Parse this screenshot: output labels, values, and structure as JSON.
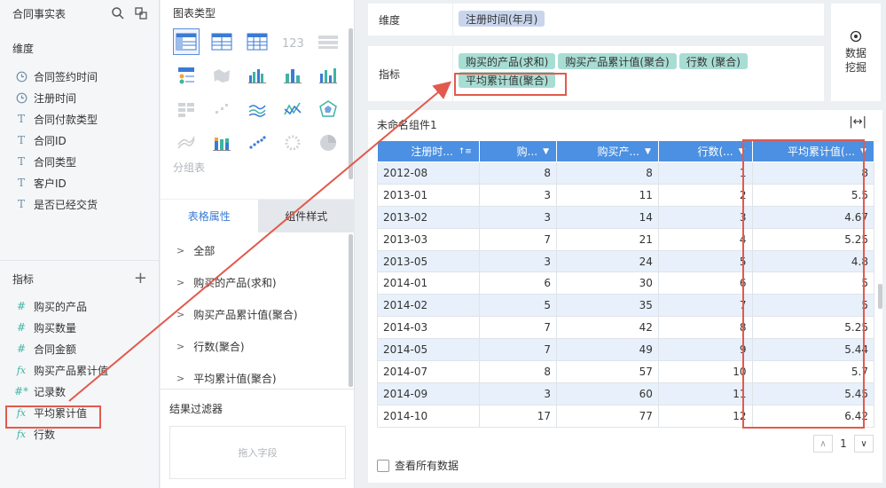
{
  "dataset": {
    "title": "合同事实表"
  },
  "dimensions": {
    "label": "维度",
    "fields": [
      {
        "type": "time",
        "label": "合同签约时间"
      },
      {
        "type": "time",
        "label": "注册时间"
      },
      {
        "type": "text",
        "label": "合同付款类型"
      },
      {
        "type": "text",
        "label": "合同ID"
      },
      {
        "type": "text",
        "label": "合同类型"
      },
      {
        "type": "text",
        "label": "客户ID"
      },
      {
        "type": "text",
        "label": "是否已经交货"
      }
    ]
  },
  "metrics": {
    "label": "指标",
    "add_icon": "plus-icon",
    "fields": [
      {
        "type": "num",
        "label": "购买的产品"
      },
      {
        "type": "num",
        "label": "购买数量"
      },
      {
        "type": "num",
        "label": "合同金额"
      },
      {
        "type": "fx",
        "label": "购买产品累计值"
      },
      {
        "type": "num",
        "label": "记录数"
      },
      {
        "type": "fx",
        "label": "平均累计值"
      },
      {
        "type": "fx",
        "label": "行数"
      }
    ]
  },
  "chart_panel": {
    "title": "图表类型",
    "group_label": "分组表",
    "tabs": [
      {
        "label": "表格属性",
        "active": true
      },
      {
        "label": "组件样式",
        "active": false
      }
    ],
    "props": [
      {
        "label": "全部"
      },
      {
        "label": "购买的产品(求和)"
      },
      {
        "label": "购买产品累计值(聚合)"
      },
      {
        "label": "行数(聚合)"
      },
      {
        "label": "平均累计值(聚合)"
      }
    ],
    "filter_title": "结果过滤器",
    "filter_placeholder": "拖入字段"
  },
  "shelves": {
    "dimension_label": "维度",
    "dimension_pills": [
      "注册时间(年月)"
    ],
    "metric_label": "指标",
    "metric_pills": [
      "购买的产品(求和)",
      "购买产品累计值(聚合)",
      "行数 (聚合)",
      "平均累计值(聚合)"
    ],
    "mining_label": "数据挖掘"
  },
  "widget": {
    "title": "未命名组件1",
    "columns": [
      "注册时...",
      "购...",
      "购买产...",
      "行数(...",
      "平均累计值(..."
    ],
    "rows": [
      [
        "2012-08",
        "8",
        "8",
        "1",
        "8"
      ],
      [
        "2013-01",
        "3",
        "11",
        "2",
        "5.5"
      ],
      [
        "2013-02",
        "3",
        "14",
        "3",
        "4.67"
      ],
      [
        "2013-03",
        "7",
        "21",
        "4",
        "5.25"
      ],
      [
        "2013-05",
        "3",
        "24",
        "5",
        "4.8"
      ],
      [
        "2014-01",
        "6",
        "30",
        "6",
        "5"
      ],
      [
        "2014-02",
        "5",
        "35",
        "7",
        "5"
      ],
      [
        "2014-03",
        "7",
        "42",
        "8",
        "5.25"
      ],
      [
        "2014-05",
        "7",
        "49",
        "9",
        "5.44"
      ],
      [
        "2014-07",
        "8",
        "57",
        "10",
        "5.7"
      ],
      [
        "2014-09",
        "3",
        "60",
        "11",
        "5.45"
      ],
      [
        "2014-10",
        "17",
        "77",
        "12",
        "6.42"
      ]
    ],
    "page": "1",
    "view_all_label": "查看所有数据"
  },
  "colors": {
    "accent": "#4b90e2",
    "highlight": "#e25a4d",
    "dim_pill": "#c8d5ec",
    "metric_pill": "#a8ddd4"
  }
}
